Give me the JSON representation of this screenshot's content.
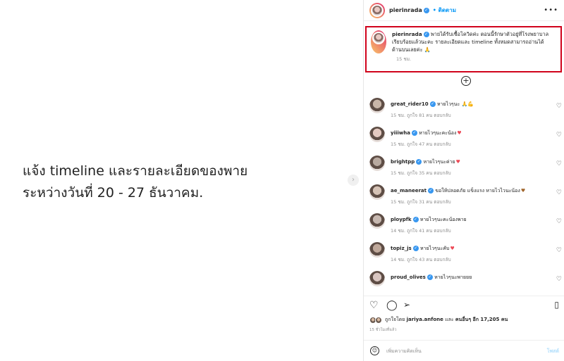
{
  "post": {
    "text_line1": "แจ้ง timeline และรายละเอียดของพาย",
    "text_line2": "ระหว่างวันที่ 20 - 27 ธันวาคม."
  },
  "header": {
    "username": "pierinrada",
    "follow_label": "• ติดตาม",
    "more": "•••"
  },
  "caption": {
    "username": "pierinrada",
    "text": " พายได้รับเชื้อโควิดค่ะ ตอนนี้รักษาตัวอยู่ที่โรงพยาบาล เรียบร้อยแล้วนะคะ รายละเอียดและ timeline ทั้งหมดสามารถอ่านได้ด้านบนเลยค่ะ 🙏",
    "time": "15 ชม."
  },
  "load_more": "+",
  "comments": [
    {
      "username": "great_rider10",
      "text": " หายไวๆนะ 🙏💪",
      "meta": "15 ชม.   ถูกใจ 81 คน   ตอบกลับ"
    },
    {
      "username": "yiiiwha",
      "text": " หายไวๆนะคะน้อง",
      "heart": "♥",
      "meta": "15 ชม.   ถูกใจ 47 คน   ตอบกลับ"
    },
    {
      "username": "brightpp",
      "text": " หายไวๆนะค่าย",
      "heart": "♥",
      "meta": "15 ชม.   ถูกใจ 35 คน   ตอบกลับ"
    },
    {
      "username": "ae_maneerat",
      "text": " ขอให้ปลอดภัย แข็งแรง หายไวไวนะน้อง",
      "heart": "♥",
      "heart_color": "brown",
      "meta": "15 ชม.   ถูกใจ 31 คน   ตอบกลับ"
    },
    {
      "username": "ploypfk",
      "text": " หายไวๆนะคะน้องพาย",
      "meta": "14 ชม.   ถูกใจ 41 คน   ตอบกลับ"
    },
    {
      "username": "topiz_js",
      "text": " หายไวๆนะคับ",
      "heart": "♥",
      "meta": "14 ชม.   ถูกใจ 43 คน   ตอบกลับ"
    },
    {
      "username": "proud_olives",
      "text": " หายไวๆนะพายยย",
      "meta": ""
    }
  ],
  "likes": {
    "prefix": "ถูกใจโดย ",
    "user": "jariya.anfone",
    "middle": " และ ",
    "others": "คนอื่นๆ อีก 17,205 คน"
  },
  "post_age": "15 ชั่วโมงที่แล้ว",
  "add_comment": {
    "placeholder": "เพิ่มความคิดเห็น",
    "post_label": "โพสต์"
  },
  "colors": {
    "highlight_border": "#d0021b",
    "link_blue": "#0095f6",
    "heart_red": "#ed4956"
  }
}
